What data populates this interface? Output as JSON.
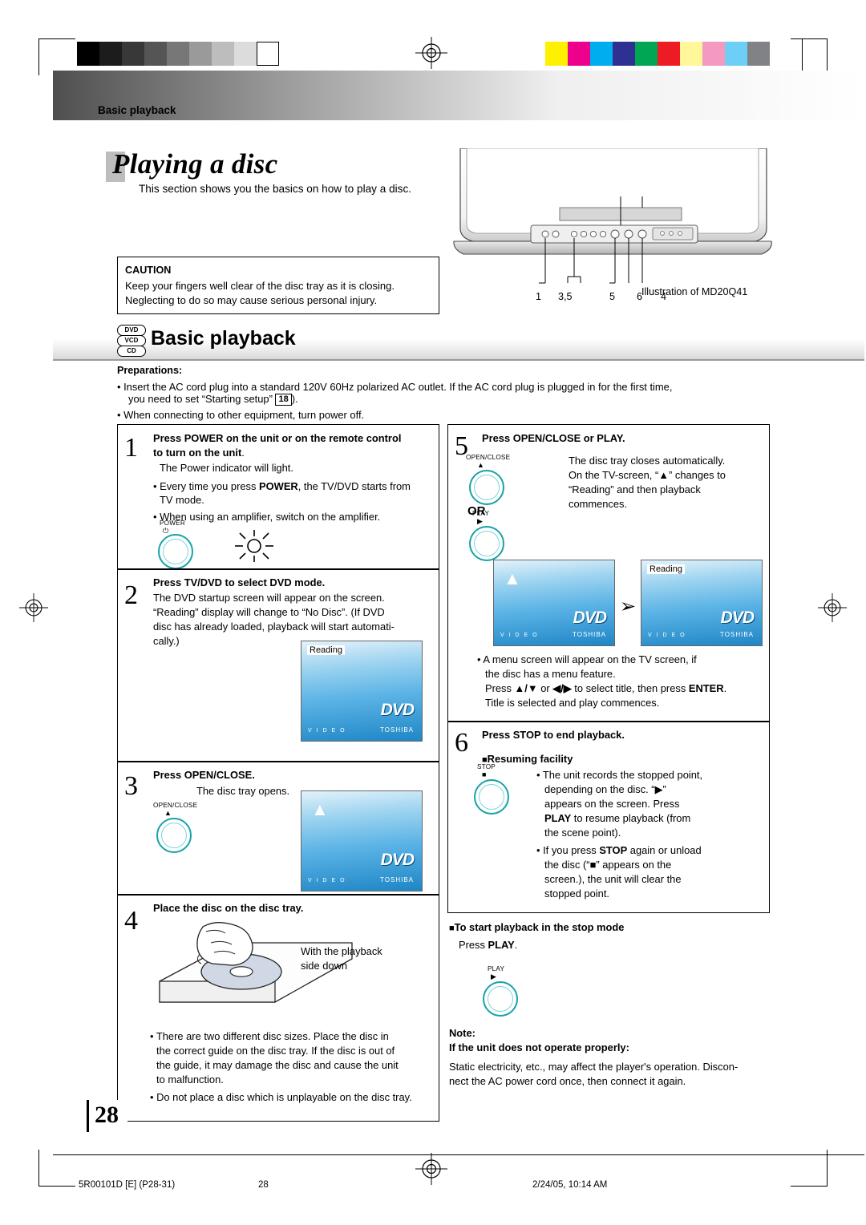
{
  "header": {
    "section": "Basic playback"
  },
  "title": {
    "main": "Playing a disc",
    "subtitle": "This section shows you the basics on how to play a disc."
  },
  "caution": {
    "heading": "CAUTION",
    "line1": "Keep your fingers well clear of the disc tray as it is closing.",
    "line2": "Neglecting to do so may cause serious personal injury."
  },
  "tv": {
    "illustration_label": "Illustration of MD20Q41",
    "callouts": [
      "1",
      "3,5",
      "5",
      "6",
      "4"
    ]
  },
  "basic_playback": {
    "badges": [
      "DVD",
      "VCD",
      "CD"
    ],
    "heading": "Basic playback",
    "preparations_label": "Preparations:",
    "prep1_a": "• Insert the AC cord plug into a standard 120V 60Hz polarized AC outlet. If the AC cord plug is plugged in for the first time,",
    "prep1_b": "you need to set “Starting setup”",
    "prep1_page": "18",
    "prep1_c": ").",
    "prep2": "• When connecting to other equipment, turn power off."
  },
  "step1": {
    "num": "1",
    "title_l1": "Press POWER on the unit or on the remote control",
    "title_l2": "to turn on the unit",
    "title_l2_end": ".",
    "body1": "The Power indicator will light.",
    "bullet1_a": "• Every time you press ",
    "bullet1_b": "POWER",
    "bullet1_c": ", the TV/DVD starts from",
    "bullet1_d": "TV mode.",
    "bullet2": "• When using an amplifier, switch on the amplifier.",
    "button_label": "POWER",
    "button_symbol": "⏻"
  },
  "step2": {
    "num": "2",
    "title": "Press TV/DVD to select DVD mode.",
    "l1": "The DVD startup screen will appear on the screen.",
    "l2": "“Reading” display will change to “No Disc”. (If DVD",
    "l3": "disc has already loaded, playback will start automati-",
    "l4": "cally.)",
    "screen_label": "Reading",
    "screen_brand": "DVD",
    "screen_maker": "TOSHIBA",
    "screen_video": "V I D E O"
  },
  "step3": {
    "num": "3",
    "title": "Press OPEN/CLOSE.",
    "body": "The disc tray opens.",
    "button_label": "OPEN/CLOSE",
    "button_symbol": "▲",
    "screen_brand": "DVD",
    "screen_maker": "TOSHIBA",
    "screen_video": "V I D E O"
  },
  "step4": {
    "num": "4",
    "title": "Place the disc on the disc tray.",
    "caption_l1": "With the playback",
    "caption_l2": "side down",
    "note1_l1": "• There are two different disc sizes. Place the disc in",
    "note1_l2": "the correct guide on the disc tray. If the disc is out of",
    "note1_l3": "the guide, it may damage the disc and cause the unit",
    "note1_l4": "to malfunction.",
    "note2": "• Do not place a disc which is unplayable on the disc tray."
  },
  "step5": {
    "num": "5",
    "title": "Press OPEN/CLOSE or PLAY.",
    "l1": "The disc tray closes automatically.",
    "l2_a": "On the TV-screen, “",
    "l2_sym": "▲",
    "l2_b": "” changes to",
    "l3": "“Reading” and then playback",
    "l4": "commences.",
    "or_label": "OR",
    "button1_label": "OPEN/CLOSE",
    "button1_symbol": "▲",
    "button2_label": "PLAY",
    "button2_symbol": "▶",
    "screen_right_label": "Reading",
    "screen_brand": "DVD",
    "screen_maker": "TOSHIBA",
    "screen_video": "V I D E O",
    "bullet_l1": "• A menu screen will appear on the TV screen, if",
    "bullet_l2": "the disc has a menu feature.",
    "bullet_l3_a": "Press ",
    "bullet_l3_arrows1": "▲/▼",
    "bullet_l3_b": " or ",
    "bullet_l3_arrows2": "◀/▶",
    "bullet_l3_c": " to select title, then press ",
    "bullet_l3_enter": "ENTER",
    "bullet_l3_d": ".",
    "bullet_l4": "Title is selected and play commences."
  },
  "step6": {
    "num": "6",
    "title": "Press STOP to end playback.",
    "sub": "Resuming facility",
    "b1_l1": "• The unit records the stopped point,",
    "b1_l2_a": "depending on the disc. “",
    "b1_l2_sym": "▶",
    "b1_l2_b": "”",
    "b1_l3": "appears on the screen. Press",
    "b1_l4_a": "PLAY",
    "b1_l4_b": " to resume playback (from",
    "b1_l5": "the scene point).",
    "b2_l1_a": "• If you press ",
    "b2_l1_stop": "STOP",
    "b2_l1_b": " again or unload",
    "b2_l2_a": "the disc (“",
    "b2_l2_sym": "■",
    "b2_l2_b": "” appears on the",
    "b2_l3": "screen.), the unit will clear the",
    "b2_l4": "stopped point.",
    "button_label": "STOP",
    "button_symbol": "■"
  },
  "stop_mode": {
    "heading": "To start playback in the stop mode",
    "body_a": "Press ",
    "body_b": "PLAY",
    "body_c": ".",
    "button_label": "PLAY",
    "button_symbol": "▶"
  },
  "note": {
    "label": "Note:",
    "heading": "If the unit does not operate properly:",
    "l1": "Static electricity, etc., may affect the player's operation. Discon-",
    "l2": "nect the AC power cord once, then connect it again."
  },
  "page_number": "28",
  "footer": {
    "left": "5R00101D [E] (P28-31)",
    "center": "28",
    "right": "2/24/05, 10:14 AM"
  },
  "colors": {
    "knob": "#17a2a8",
    "screen_top": "#cfe9f8",
    "screen_bottom": "#1b7fc0"
  }
}
